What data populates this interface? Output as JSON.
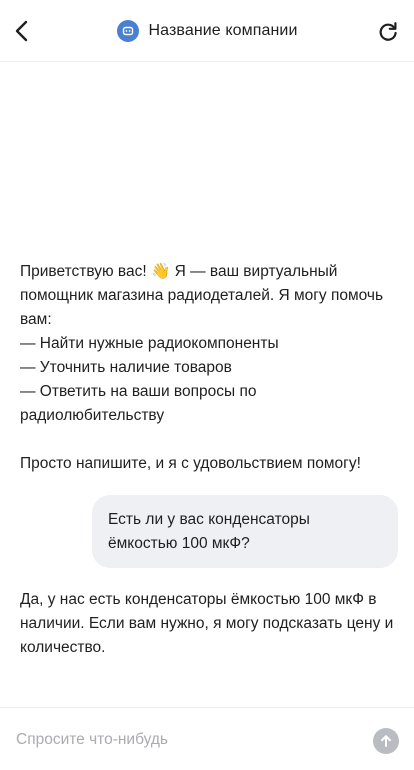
{
  "header": {
    "title": "Название компании",
    "back_icon": "chevron-left-icon",
    "refresh_icon": "refresh-icon",
    "avatar_icon": "bot-icon",
    "avatar_color": "#4a7fd1"
  },
  "messages": {
    "bot_greeting": "Приветствую вас! 👋 Я — ваш виртуальный помощник магазина радиодеталей. Я могу помочь вам:\n— Найти нужные радиокомпоненты\n— Уточнить наличие товаров\n— Ответить на ваши вопросы по радиолюбительству\n\nПросто напишите, и я с удовольствием помогу!",
    "user_question": "Есть ли у вас конденсаторы ёмкостью 100 мкФ?",
    "bot_answer": "Да, у нас есть конденсаторы ёмкостью 100 мкФ в наличии. Если вам нужно, я могу подсказать цену и количество."
  },
  "composer": {
    "placeholder": "Спросите что-нибудь",
    "value": "",
    "send_icon": "arrow-up-icon"
  }
}
